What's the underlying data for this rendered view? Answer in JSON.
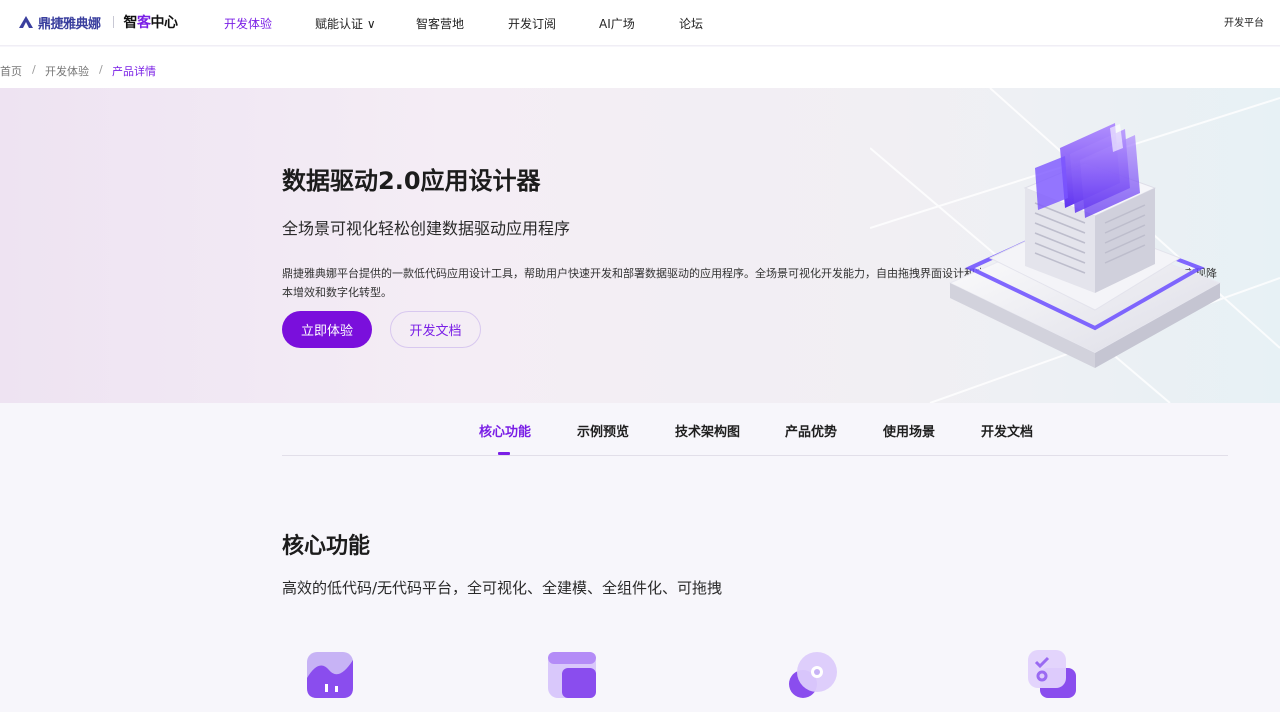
{
  "brand": {
    "name": "鼎捷雅典娜",
    "center_prefix": "智",
    "center_accent": "客",
    "center_suffix": "中心",
    "accent_color": "#7a1fe6"
  },
  "nav": {
    "items": [
      "开发体验",
      "赋能认证 ∨",
      "智客营地",
      "开发订阅",
      "AI广场",
      "论坛"
    ],
    "active_index": 0,
    "right_link": "开发平台"
  },
  "breadcrumb": {
    "items": [
      "首页",
      "开发体验",
      "产品详情"
    ],
    "separator": "/"
  },
  "hero": {
    "title": "数据驱动2.0应用设计器",
    "subtitle": "全场景可视化轻松创建数据驱动应用程序",
    "description": "鼎捷雅典娜平台提供的一款低代码应用设计工具，帮助用户快速开发和部署数据驱动的应用程序。全场景可视化开发能力，自由拖拽界面设计和丰富的预建模块，即可轻松创建应用，助力实现降本增效和数字化转型。",
    "primary_button": "立即体验",
    "secondary_button": "开发文档"
  },
  "tabs": {
    "items": [
      "核心功能",
      "示例预览",
      "技术架构图",
      "产品优势",
      "使用场景",
      "开发文档"
    ],
    "active_index": 0
  },
  "core": {
    "title": "核心功能",
    "subtitle": "高效的低代码/无代码平台，全可视化、全建模、全组件化、可拖拽",
    "feature_icons": [
      "chart-card-icon",
      "layout-grid-icon",
      "disc-icon",
      "checklist-icon"
    ]
  }
}
